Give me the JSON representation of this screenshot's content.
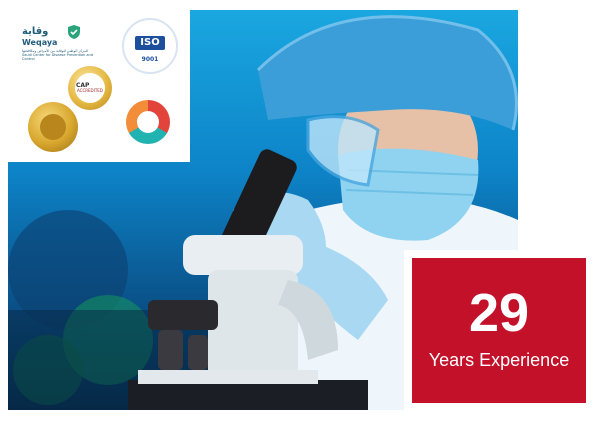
{
  "logos": {
    "wegaya_arabic": "وقاية",
    "wegaya_name": "Weqaya",
    "wegaya_subtitle": "المركز الوطني للوقاية من الأمراض ومكافحتها Saudi Center for Disease Prevention and Control",
    "iso_label": "ISO",
    "iso_number": "9001",
    "cap_label": "CAP",
    "cap_sub": "ACCREDITED"
  },
  "stats": {
    "value": "29",
    "label": "Years Experience"
  },
  "colors": {
    "accent_red": "#c4112a",
    "sky_blue": "#1aa7e0"
  }
}
